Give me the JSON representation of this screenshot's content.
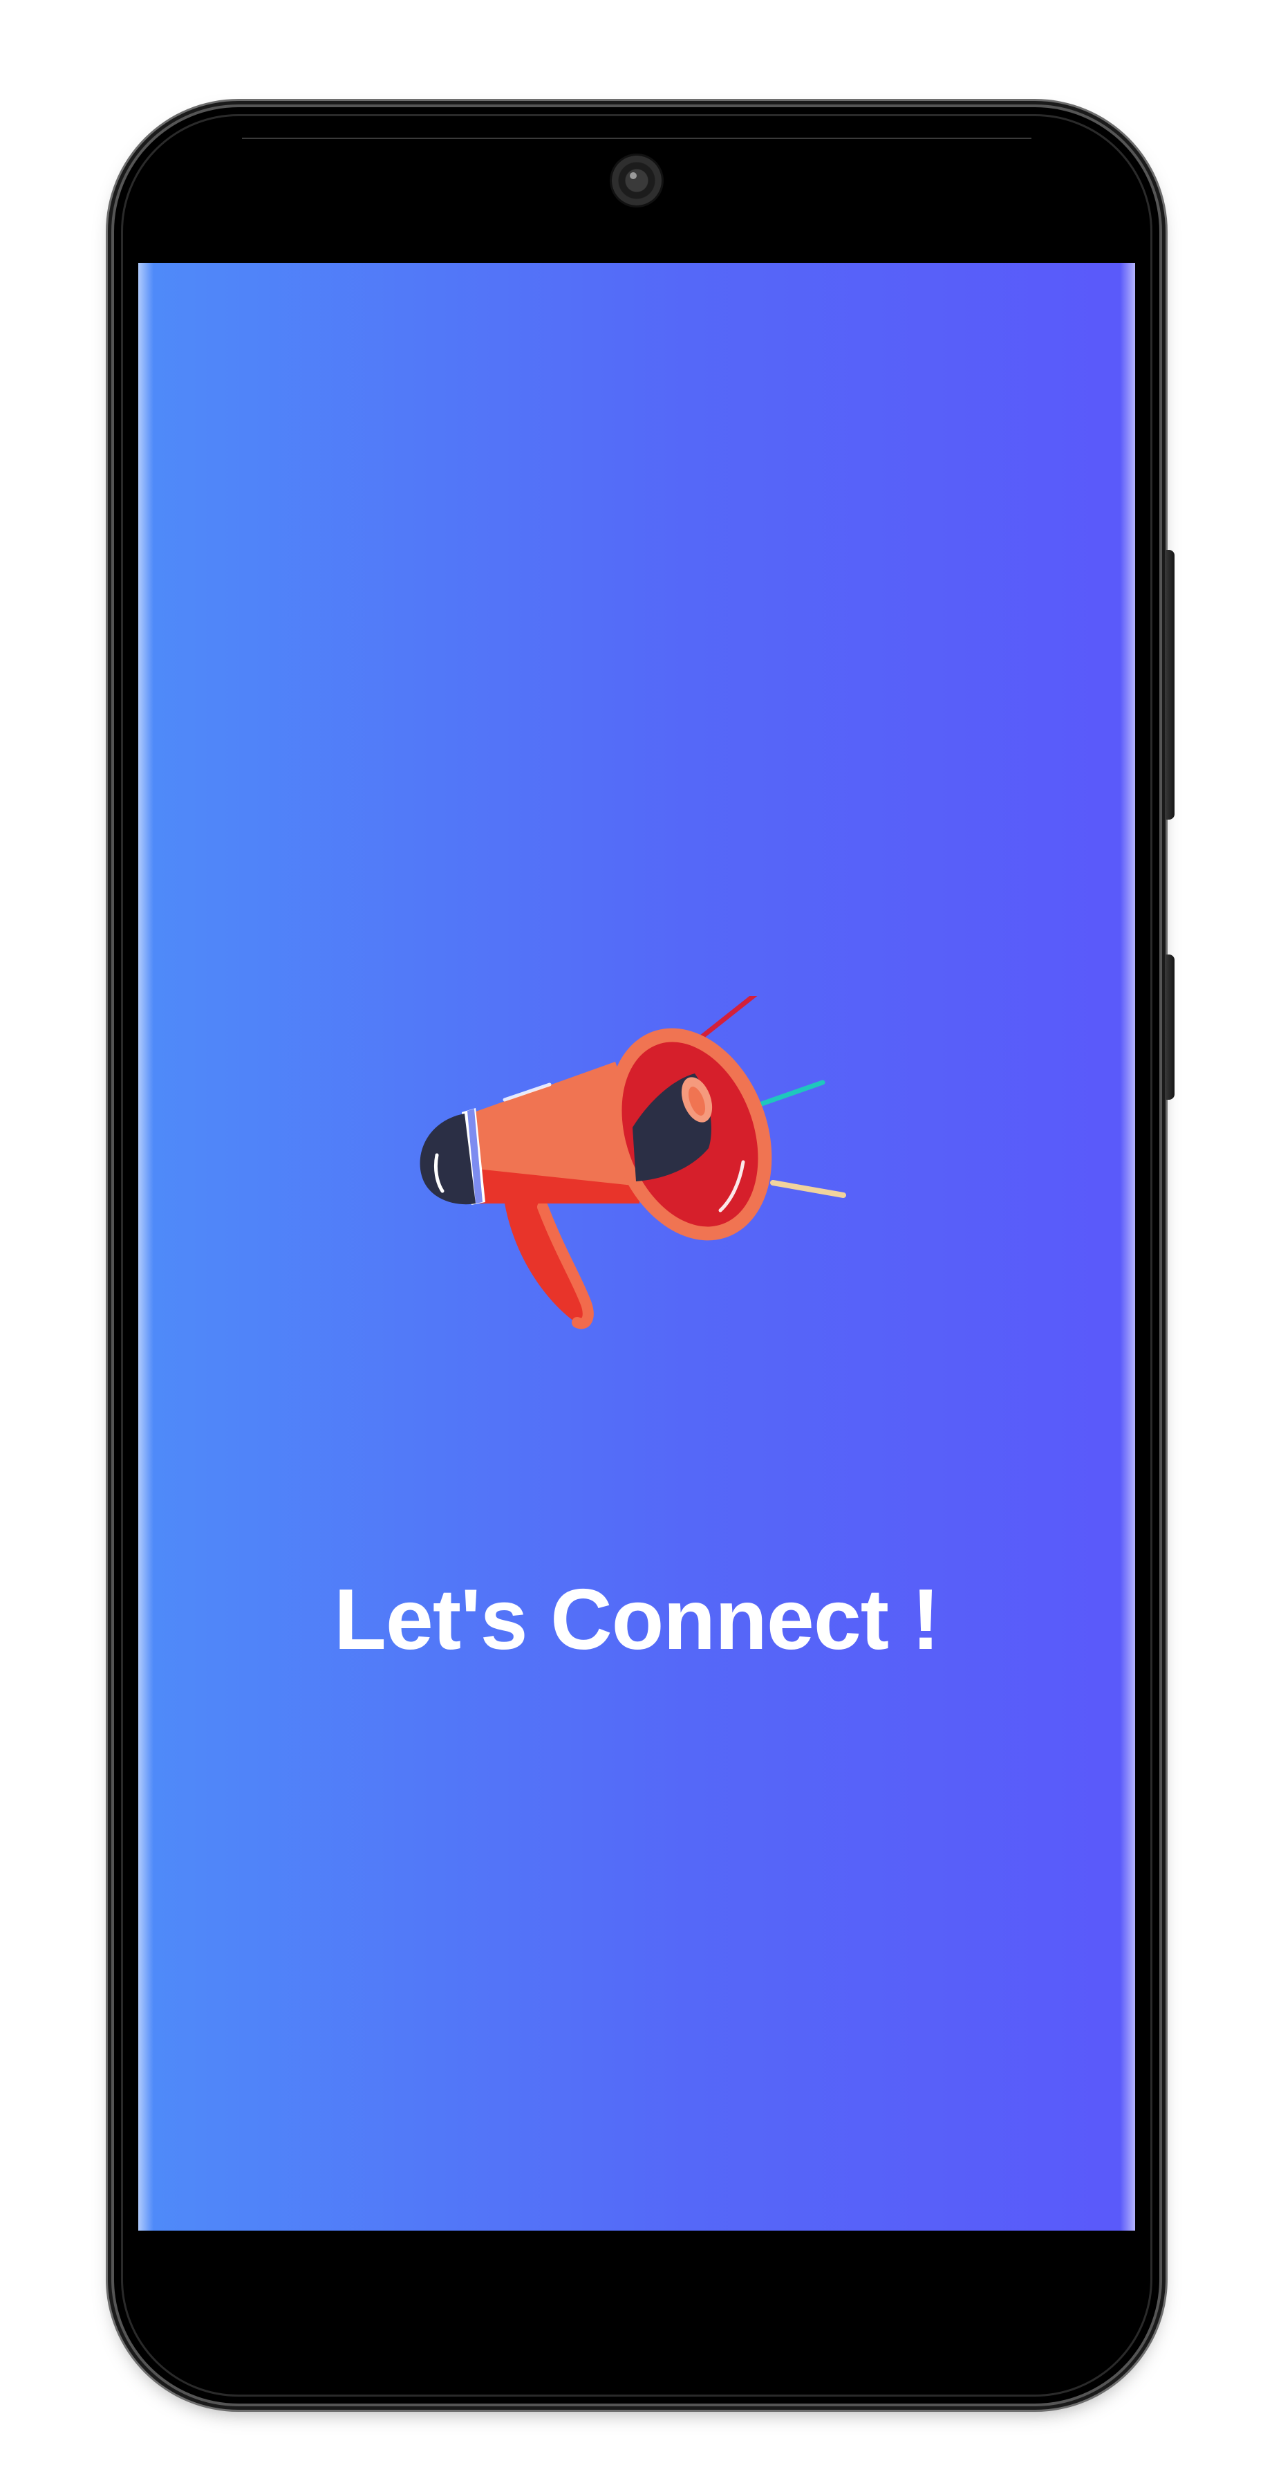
{
  "screen": {
    "title": "Let's Connect !",
    "illustration": "megaphone-icon"
  },
  "colors": {
    "gradient_start": "#4f8bf9",
    "gradient_end": "#5a59fa",
    "title_text": "#ffffff",
    "megaphone_body": "#ee6b4d",
    "megaphone_dark": "#2b2f45",
    "megaphone_inner": "#d61f2b"
  }
}
